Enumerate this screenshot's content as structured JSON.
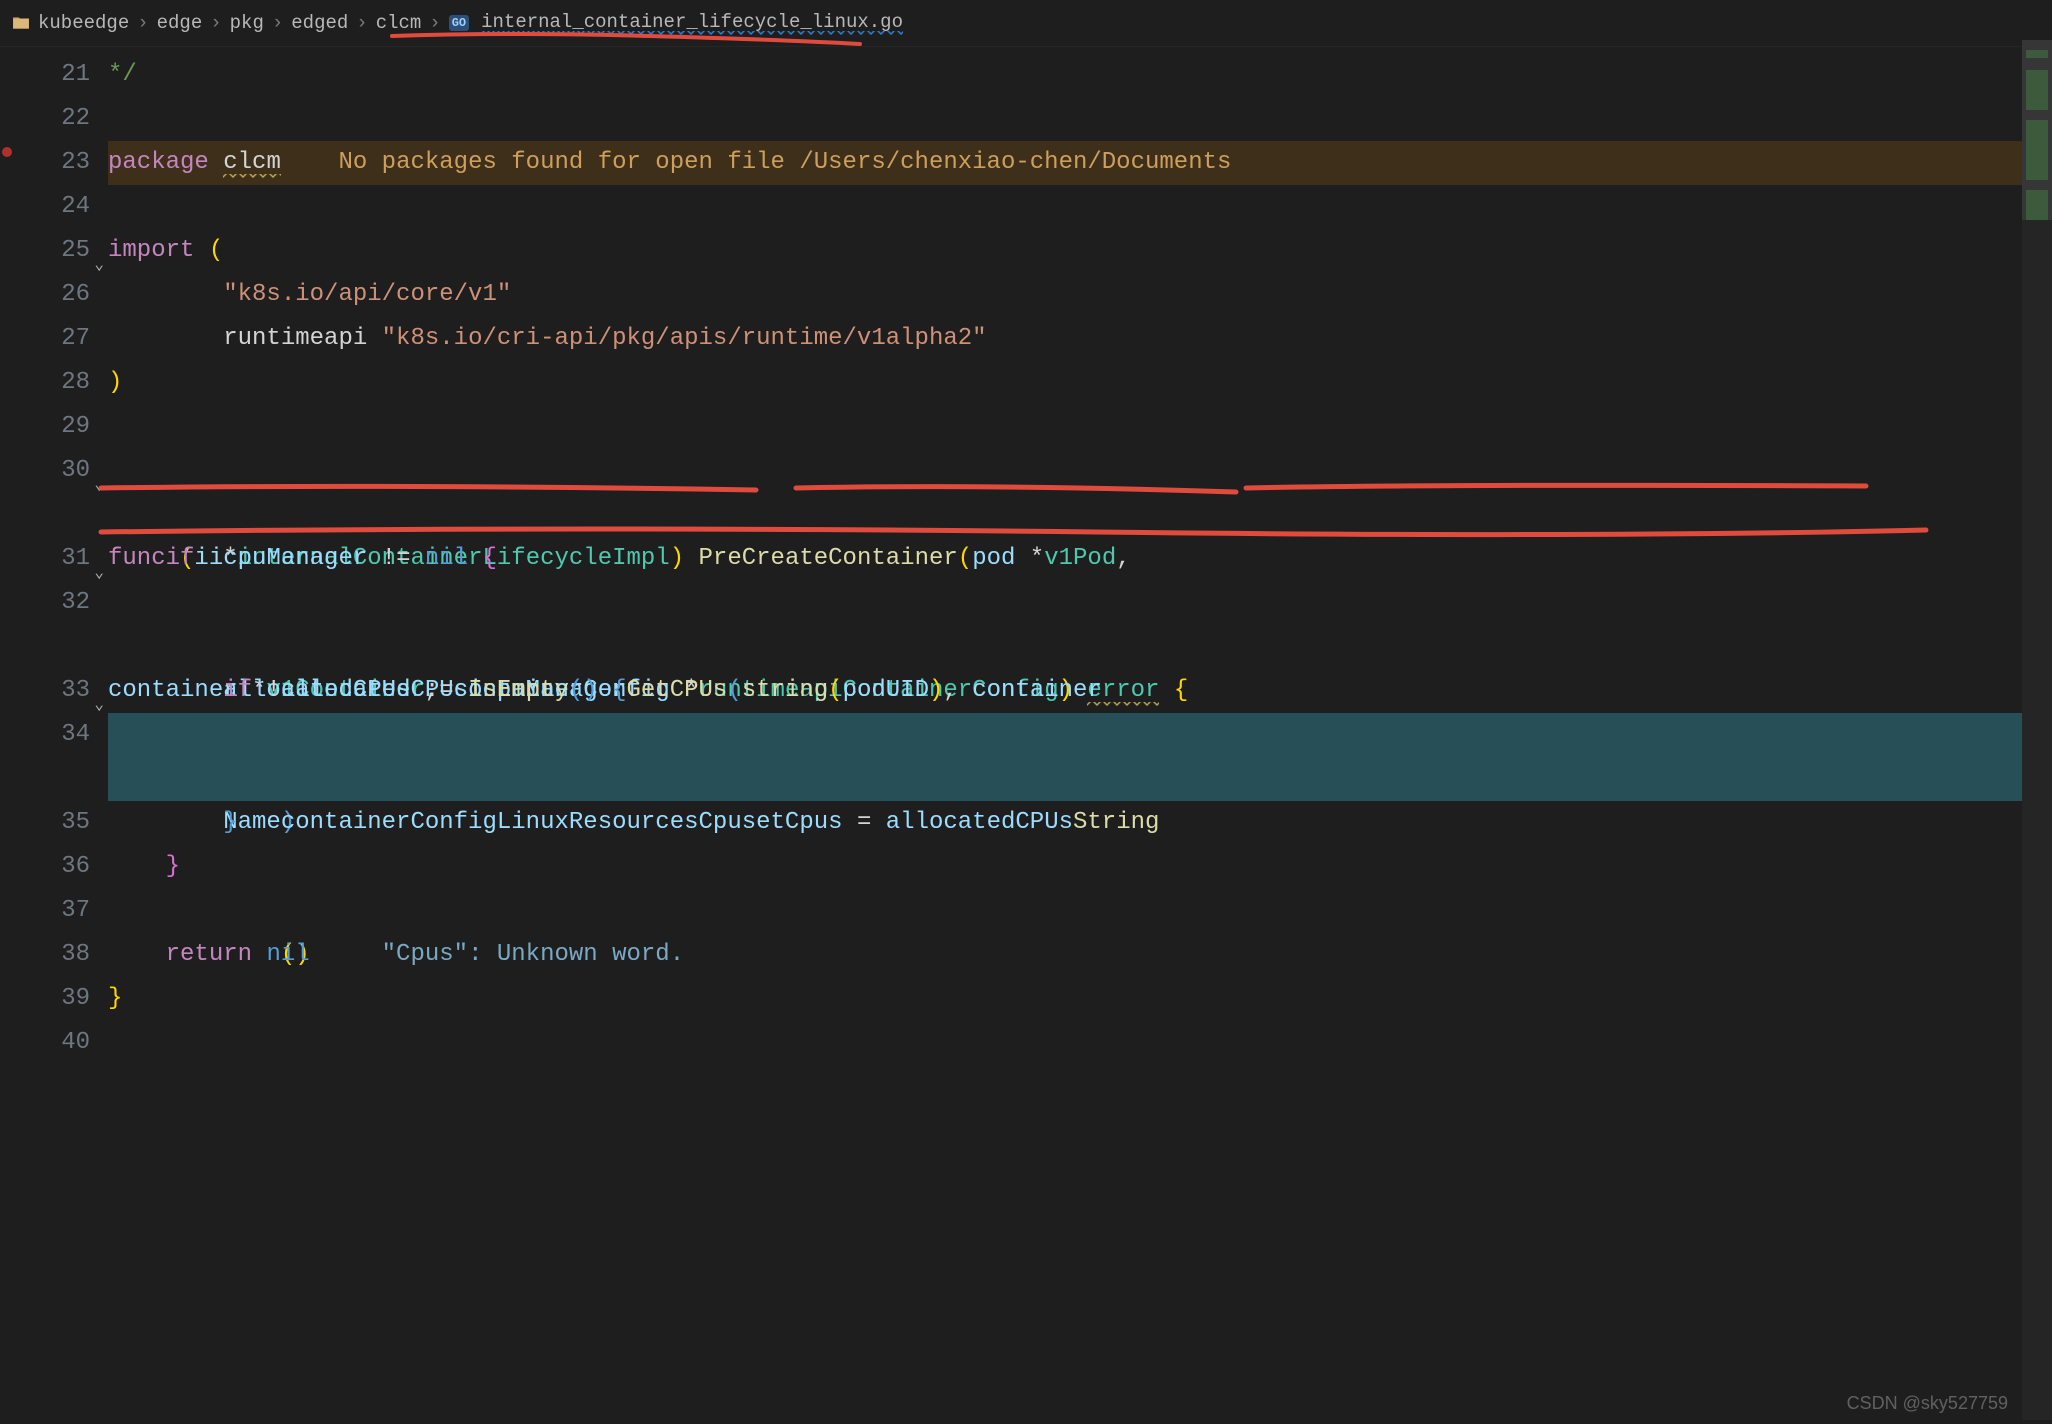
{
  "breadcrumb": {
    "items": [
      "kubeedge",
      "edge",
      "pkg",
      "edged",
      "clcm"
    ],
    "file_icon": "GO",
    "file_name": "internal_container_lifecycle_linux.go",
    "sep": "›"
  },
  "gutter": {
    "lines": [
      "21",
      "22",
      "23",
      "24",
      "25",
      "26",
      "27",
      "28",
      "29",
      "30",
      "31",
      "32",
      "33",
      "34",
      "35",
      "36",
      "37",
      "38",
      "39",
      "40"
    ],
    "folds": {
      "25": "⌄",
      "30": "⌄",
      "31": "⌄",
      "33": "⌄"
    }
  },
  "code": {
    "l21": "*/",
    "l23": {
      "kw": "package",
      "name": "clcm",
      "warn": "    No packages found for open file /Users/chenxiao-chen/Documents"
    },
    "l25": {
      "kw": "import",
      "p": " ("
    },
    "l26": {
      "indent": "        ",
      "str": "\"k8s.io/api/core/v1\""
    },
    "l27": {
      "indent": "        ",
      "ident": "runtimeapi ",
      "str": "\"k8s.io/cri-api/pkg/apis/runtime/v1alpha2\""
    },
    "l28": ")",
    "l30": {
      "a": "func ",
      "p1": "(",
      "recv": "i ",
      "star": "*",
      "type": "internalContainerLifecycleImpl",
      "p2": ") ",
      "fn": "PreCreateContainer",
      "p3": "(",
      "arg1": "pod ",
      "star2": "*",
      "ns1": "v1",
      ".1": ".",
      "t1": "Pod",
      ", ": ", ",
      "l2_arg": "container ",
      "star3": "*",
      "ns2": "v1",
      ".2": ".",
      "t2": "Container",
      "arg3": "containerConfig ",
      "star4": "*",
      "ns3": "runtimeapi",
      ".3": ".",
      "t3": "ContainerConfig",
      "p4": ") ",
      "err": "error",
      " b": " {"
    },
    "l31": {
      "indent": "    ",
      "kw": "if ",
      "i": "i",
      ".": ".",
      "prop": "cpuManager",
      " op": " != ",
      "nil": "nil",
      " b": " {"
    },
    "l32": {
      "indent": "        ",
      "var": "allocatedCPUs",
      " op": " := ",
      "i": "i",
      ".1": ".",
      "p1": "cpuManager",
      ".2": ".",
      "call": "GetCPUs",
      "(": "(",
      "s": "string",
      "(2": "(",
      "pod": "pod",
      ".3": ".",
      "uid": "UID",
      ")": ")",
      ", ": ", ",
      "cont": "container",
      ".4": ".",
      "l2_indent": "        ",
      "name": "Name",
      ")2": ")"
    },
    "l33": {
      "indent": "        ",
      "kw": "if ",
      "!": "!",
      "var": "allocatedCPUs",
      ".": ".",
      "call": "IsEmpty",
      "()": "()",
      " b": " {"
    },
    "l34": {
      "indent": "            ",
      "cc": "containerConfig",
      ".1": ".",
      "lx": "Linux",
      ".2": ".",
      "rs": "Resources",
      ".3": ".",
      "cpuset": "CpusetCpus",
      " = ": " = ",
      "ac": "allocatedCPUs",
      ".4": ".",
      "str": "String",
      "l2_indent": "            ",
      "()": "()",
      "pad": "     ",
      "hint": "\"Cpus\": Unknown word."
    },
    "l35": {
      "indent": "        ",
      "b": "}"
    },
    "l36": {
      "indent": "    ",
      "b": "}"
    },
    "l38": {
      "indent": "    ",
      "kw": "return ",
      "nil": "nil"
    },
    "l39": "}"
  },
  "watermark": "CSDN @sky527759"
}
